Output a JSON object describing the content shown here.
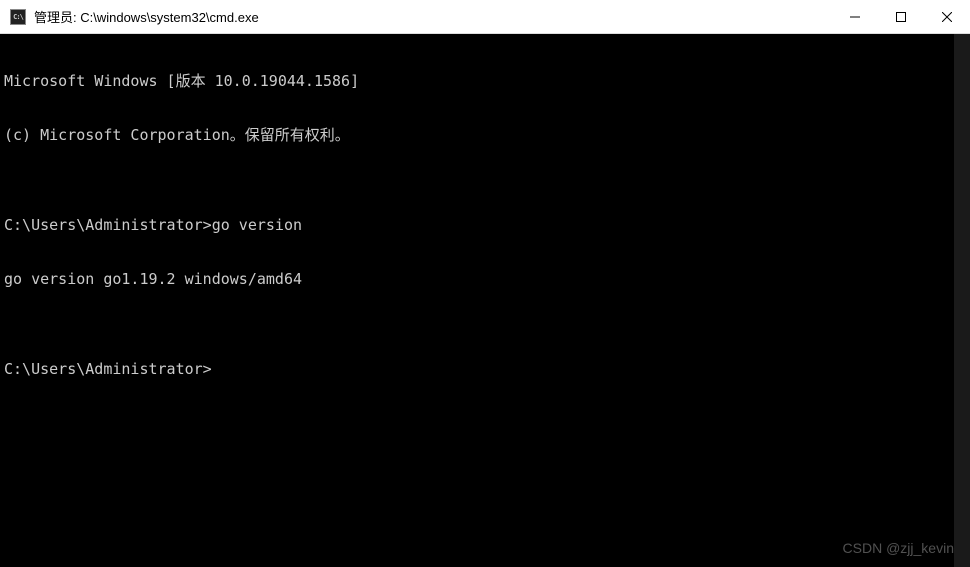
{
  "window": {
    "title": "管理员: C:\\windows\\system32\\cmd.exe",
    "icon_text": "C:\\"
  },
  "terminal": {
    "lines": {
      "banner1": "Microsoft Windows [版本 10.0.19044.1586]",
      "banner2": "(c) Microsoft Corporation。保留所有权利。",
      "blank": "",
      "prompt1": "C:\\Users\\Administrator>",
      "cmd1": "go version",
      "output1": "go version go1.19.2 windows/amd64",
      "prompt2": "C:\\Users\\Administrator>"
    }
  },
  "watermark": "CSDN @zjj_kevin"
}
